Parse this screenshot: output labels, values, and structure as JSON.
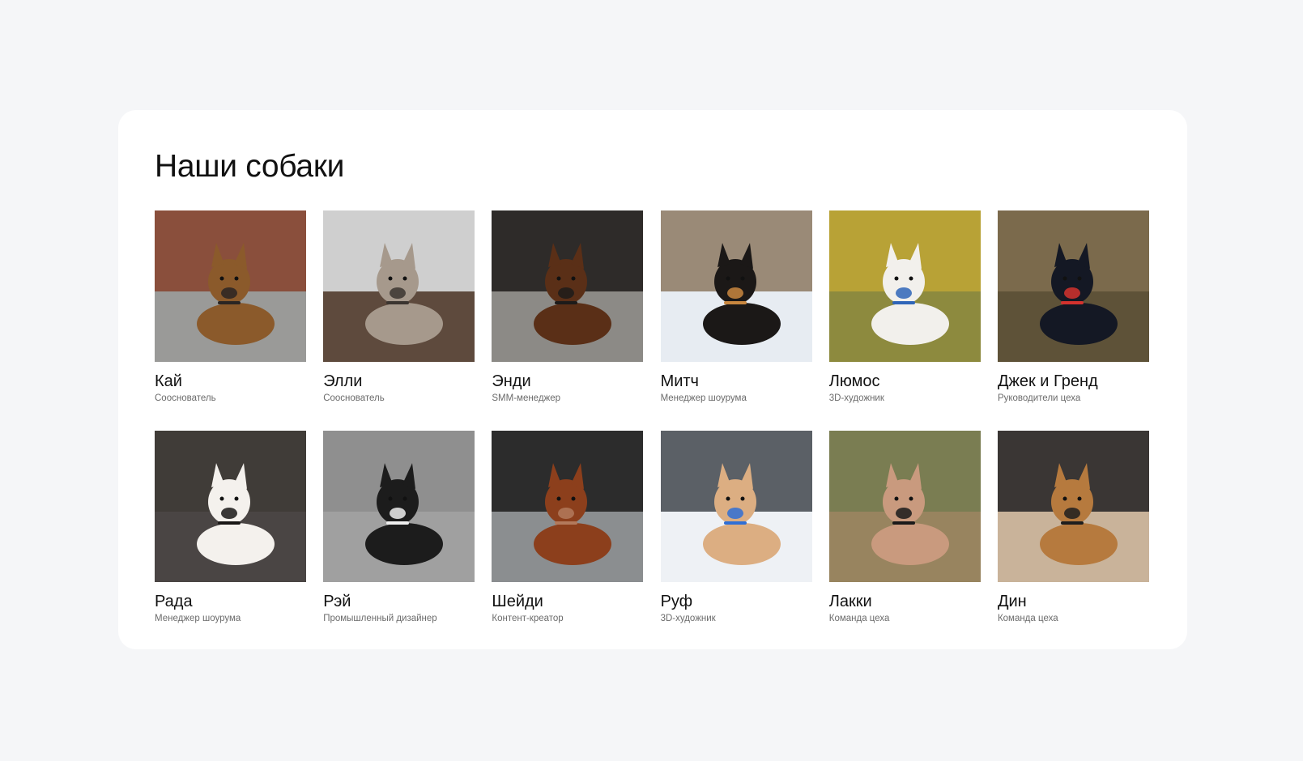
{
  "page": {
    "title": "Наши собаки"
  },
  "dogs": [
    {
      "name": "Кай",
      "role": "Сооснователь",
      "photo_icon": "dog-photo-icon",
      "colors": {
        "bg": "#8a4f3c",
        "ground": "#9a9a98",
        "dog": "#8b5a2b",
        "accent": "#2a2523"
      }
    },
    {
      "name": "Элли",
      "role": "Сооснователь",
      "photo_icon": "dog-photo-icon",
      "colors": {
        "bg": "#cfcfcf",
        "ground": "#5e4a3d",
        "dog": "#a6998c",
        "accent": "#3b3530"
      }
    },
    {
      "name": "Энди",
      "role": "SMM-менеджер",
      "photo_icon": "dog-photo-icon",
      "colors": {
        "bg": "#2e2b29",
        "ground": "#8c8a86",
        "dog": "#5a2f17",
        "accent": "#1d1b1a"
      }
    },
    {
      "name": "Митч",
      "role": "Менеджер шоурума",
      "photo_icon": "dog-photo-icon",
      "colors": {
        "bg": "#9a8a77",
        "ground": "#e7ecf2",
        "dog": "#1b1817",
        "accent": "#c9873f"
      }
    },
    {
      "name": "Люмос",
      "role": "3D-художник",
      "photo_icon": "dog-photo-icon",
      "colors": {
        "bg": "#b8a236",
        "ground": "#8d8a3e",
        "dog": "#f2f0ec",
        "accent": "#2f65b8"
      }
    },
    {
      "name": "Джек и Гренд",
      "role": "Руководители цеха",
      "photo_icon": "dog-photo-icon",
      "colors": {
        "bg": "#7b6a4c",
        "ground": "#5e5238",
        "dog": "#141824",
        "accent": "#d4322e"
      }
    },
    {
      "name": "Рада",
      "role": "Менеджер шоурума",
      "photo_icon": "dog-photo-icon",
      "colors": {
        "bg": "#403c38",
        "ground": "#4a4544",
        "dog": "#f4f1ed",
        "accent": "#191716"
      }
    },
    {
      "name": "Рэй",
      "role": "Промышленный дизайнер",
      "photo_icon": "dog-photo-icon",
      "colors": {
        "bg": "#8f8f8f",
        "ground": "#a0a0a0",
        "dog": "#1c1c1c",
        "accent": "#efefef"
      }
    },
    {
      "name": "Шейди",
      "role": "Контент-креатор",
      "photo_icon": "dog-photo-icon",
      "colors": {
        "bg": "#2c2c2c",
        "ground": "#8b8e90",
        "dog": "#8c3f1c",
        "accent": "#b37a5c"
      }
    },
    {
      "name": "Руф",
      "role": "3D-художник",
      "photo_icon": "dog-photo-icon",
      "colors": {
        "bg": "#5b6066",
        "ground": "#eef1f5",
        "dog": "#dcae82",
        "accent": "#2f6fd6"
      }
    },
    {
      "name": "Лакки",
      "role": "Команда цеха",
      "photo_icon": "dog-photo-icon",
      "colors": {
        "bg": "#7a7d52",
        "ground": "#98845f",
        "dog": "#c99a7e",
        "accent": "#1a1a1a"
      }
    },
    {
      "name": "Дин",
      "role": "Команда цеха",
      "photo_icon": "dog-photo-icon",
      "colors": {
        "bg": "#3a3634",
        "ground": "#c9b39a",
        "dog": "#b67a3e",
        "accent": "#1e1e1e"
      }
    }
  ]
}
